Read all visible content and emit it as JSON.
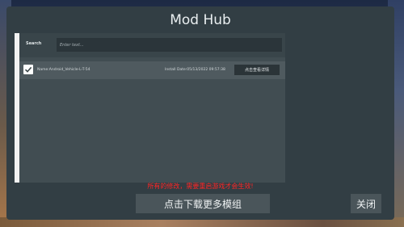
{
  "window": {
    "title": "Mod Hub"
  },
  "search": {
    "label": "Search",
    "placeholder": "Enter text..."
  },
  "mods": [
    {
      "name": "Name:Android_Vehicle-L-T-54",
      "install_date": "Install Date:05/13/2022 09:57:38",
      "detail_button": "点击查看详情",
      "enabled": true
    }
  ],
  "notice": "所有的修改，需要重启游戏才会生效!",
  "buttons": {
    "download_more": "点击下载更多模组",
    "close": "关闭"
  },
  "colors": {
    "notice": "#ff2626",
    "panel": "#323e44"
  }
}
